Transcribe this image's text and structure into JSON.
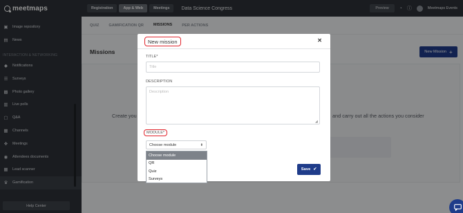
{
  "brand": {
    "logo_text": "meetmaps",
    "accent": "#1f3c8a",
    "highlight": "#e0232b"
  },
  "sidebar": {
    "items_top": [
      {
        "label": "Image repository",
        "icon": "image-icon"
      },
      {
        "label": "News",
        "icon": "news-icon"
      }
    ],
    "section_label": "INTERACTION & NETWORKING",
    "items": [
      {
        "label": "Notifications",
        "icon": "bell-icon"
      },
      {
        "label": "Surveys",
        "icon": "list-icon"
      },
      {
        "label": "Photo gallery",
        "icon": "photo-icon"
      },
      {
        "label": "Live polls",
        "icon": "poll-icon"
      },
      {
        "label": "Q&A",
        "icon": "chat-icon"
      },
      {
        "label": "Channels",
        "icon": "channels-icon"
      },
      {
        "label": "Meetings",
        "icon": "handshake-icon"
      },
      {
        "label": "Attendees documents",
        "icon": "globe-icon"
      },
      {
        "label": "Lead scanner",
        "icon": "qr-icon"
      },
      {
        "label": "Gamification",
        "icon": "trophy-icon"
      }
    ],
    "help_label": "Help Center"
  },
  "topbar": {
    "tabs": [
      "Registration",
      "App & Web",
      "Meetings"
    ],
    "event_title": "Data Science Congress",
    "preview_label": "Preview",
    "user_name": "Meetmaps Events"
  },
  "subtabs": [
    "QUIZ",
    "GAMIFICATION QR",
    "MISSIONS",
    "PER ACTIONS"
  ],
  "main": {
    "title": "Missions",
    "new_mission_label": "New Mission",
    "empty_left": "Create you",
    "empty_right": "and carry out all the actions you consider"
  },
  "modal": {
    "title": "New mission",
    "title_label": "TITLE*",
    "title_placeholder": "Title",
    "description_label": "DESCRIPTION",
    "description_placeholder": "Description",
    "module_label": "MODULE*",
    "module_selected": "Choose module",
    "module_options": [
      "Choose module",
      "QR",
      "Quiz",
      "Surveys"
    ],
    "save_label": "Save"
  }
}
